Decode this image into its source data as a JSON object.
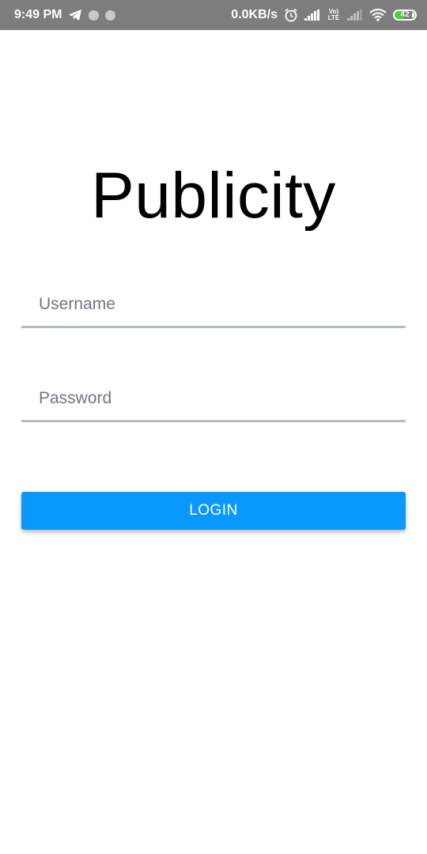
{
  "status_bar": {
    "time": "9:49 PM",
    "net_speed": "0.0KB/s",
    "volte_line1": "Vo)",
    "volte_line2": "LTE",
    "battery_level": "42",
    "battery_fraction": 0.42,
    "icons": [
      "telegram-icon",
      "notification-dot-icon",
      "notification-dot-icon",
      "alarm-icon",
      "signal-icon",
      "volte-icon",
      "signal-weak-icon",
      "wifi-icon",
      "battery-icon"
    ]
  },
  "app": {
    "title": "Publicity"
  },
  "login_form": {
    "username_placeholder": "Username",
    "password_placeholder": "Password",
    "login_label": "LOGIN"
  },
  "colors": {
    "status_bar_bg": "#7d7d7d",
    "accent": "#0a98ff",
    "field_underline": "#b4bcc2",
    "battery_green": "#4cd137"
  }
}
